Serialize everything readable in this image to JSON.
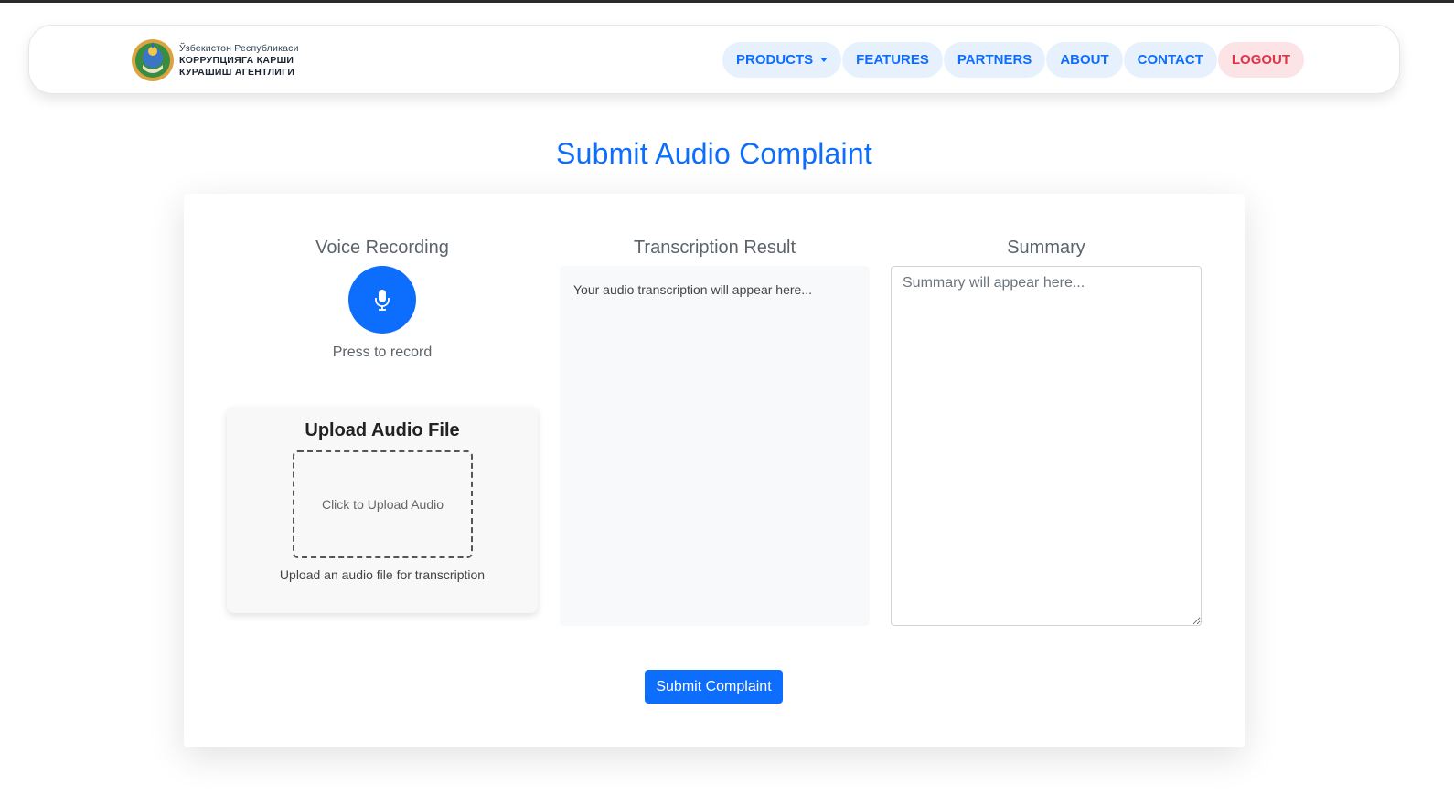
{
  "brand": {
    "line1": "Ўзбекистон Республикаси",
    "line2": "КОРРУПЦИЯГА ҚАРШИ",
    "line3": "КУРАШИШ АГЕНТЛИГИ",
    "emblem_icon": "state-emblem-icon"
  },
  "nav": {
    "items": [
      {
        "label": "PRODUCTS"
      },
      {
        "label": "FEATURES"
      },
      {
        "label": "PARTNERS"
      },
      {
        "label": "ABOUT"
      },
      {
        "label": "CONTACT"
      },
      {
        "label": "LOGOUT"
      }
    ]
  },
  "page": {
    "title": "Submit Audio Complaint"
  },
  "recording": {
    "title": "Voice Recording",
    "press_text": "Press to record",
    "icon": "microphone-icon"
  },
  "upload": {
    "title": "Upload Audio File",
    "zone_text": "Click to Upload Audio",
    "hint": "Upload an audio file for transcription"
  },
  "transcription": {
    "title": "Transcription Result",
    "placeholder": "Your audio transcription will appear here..."
  },
  "summary": {
    "title": "Summary",
    "placeholder": "Summary will appear here..."
  },
  "submit": {
    "label": "Submit Complaint"
  },
  "colors": {
    "accent": "#0d6efd",
    "danger": "#dc3545",
    "nav_bg": "#e7f1fd"
  }
}
